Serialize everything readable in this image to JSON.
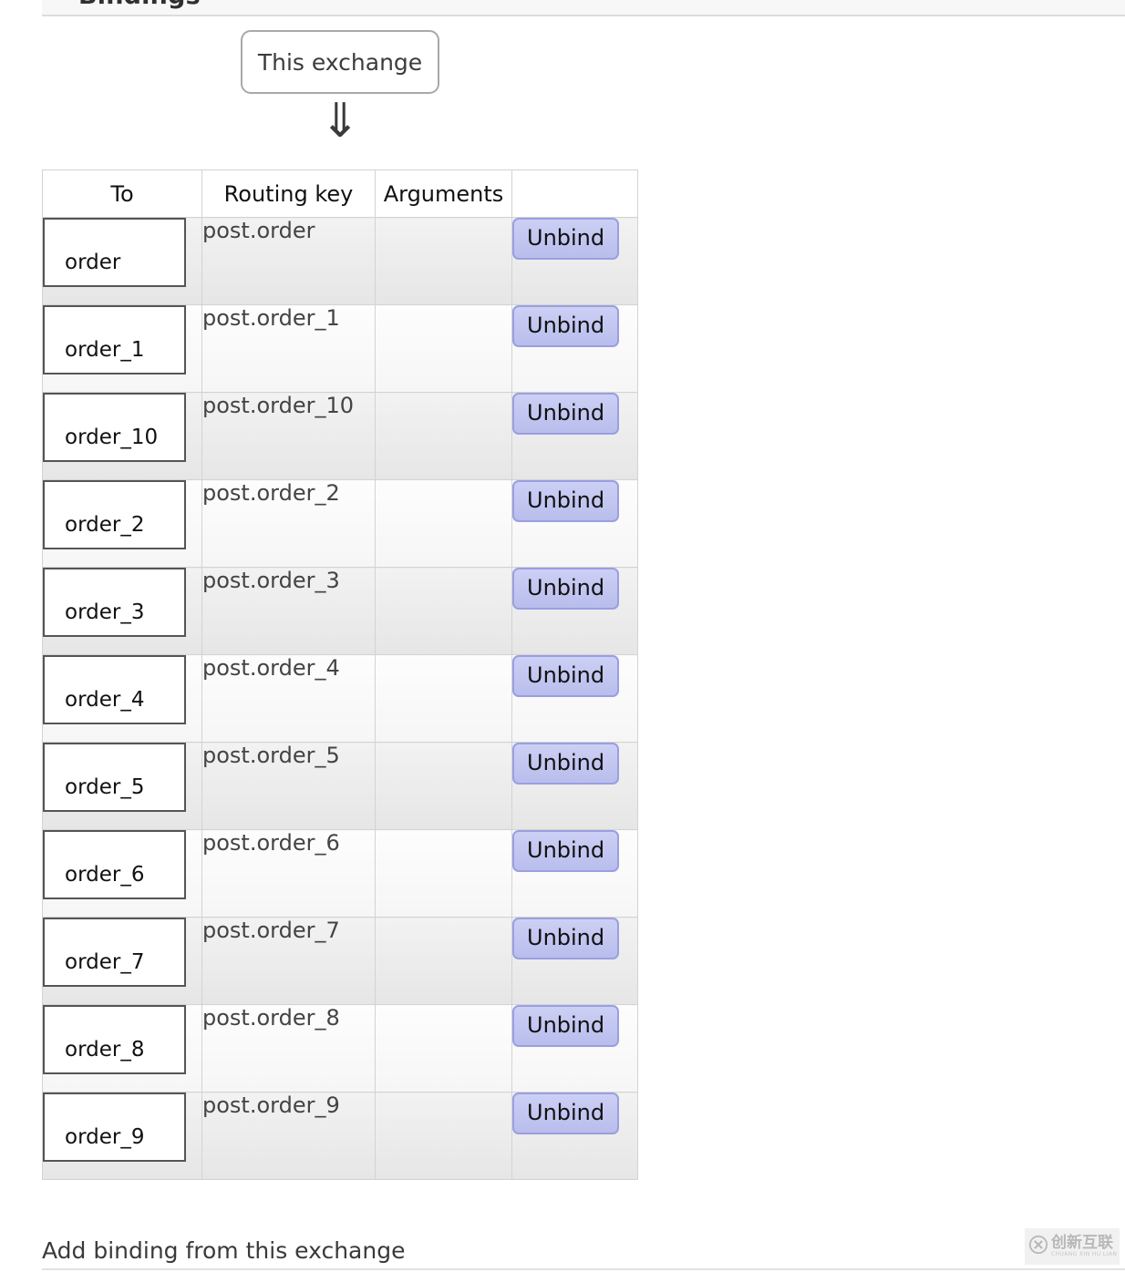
{
  "section": {
    "title": "Bindings",
    "caret_icon": "triangle-down-icon"
  },
  "diagram": {
    "source_label": "This exchange",
    "arrow_icon": "double-down-arrow-icon",
    "arrow_glyph": "⇓"
  },
  "table": {
    "columns": [
      "To",
      "Routing key",
      "Arguments",
      ""
    ],
    "rows": [
      {
        "to": "order",
        "routing_key": "post.order",
        "arguments": "",
        "action": "Unbind"
      },
      {
        "to": "order_1",
        "routing_key": "post.order_1",
        "arguments": "",
        "action": "Unbind"
      },
      {
        "to": "order_10",
        "routing_key": "post.order_10",
        "arguments": "",
        "action": "Unbind"
      },
      {
        "to": "order_2",
        "routing_key": "post.order_2",
        "arguments": "",
        "action": "Unbind"
      },
      {
        "to": "order_3",
        "routing_key": "post.order_3",
        "arguments": "",
        "action": "Unbind"
      },
      {
        "to": "order_4",
        "routing_key": "post.order_4",
        "arguments": "",
        "action": "Unbind"
      },
      {
        "to": "order_5",
        "routing_key": "post.order_5",
        "arguments": "",
        "action": "Unbind"
      },
      {
        "to": "order_6",
        "routing_key": "post.order_6",
        "arguments": "",
        "action": "Unbind"
      },
      {
        "to": "order_7",
        "routing_key": "post.order_7",
        "arguments": "",
        "action": "Unbind"
      },
      {
        "to": "order_8",
        "routing_key": "post.order_8",
        "arguments": "",
        "action": "Unbind"
      },
      {
        "to": "order_9",
        "routing_key": "post.order_9",
        "arguments": "",
        "action": "Unbind"
      }
    ]
  },
  "footer": {
    "add_binding_label": "Add binding from this exchange"
  },
  "watermark": {
    "icon": "circled-x-logo-icon",
    "text_cn": "创新互联",
    "text_pinyin": "CHUANG XIN HU LIAN"
  },
  "colors": {
    "accent_button_bg": "#c5c8f0",
    "accent_button_border": "#9a9fe0",
    "table_border": "#d3d3d3",
    "row_odd_bg": "#ececec",
    "row_even_bg": "#fbfbfb",
    "text_primary": "#111111",
    "text_secondary": "#444444"
  }
}
